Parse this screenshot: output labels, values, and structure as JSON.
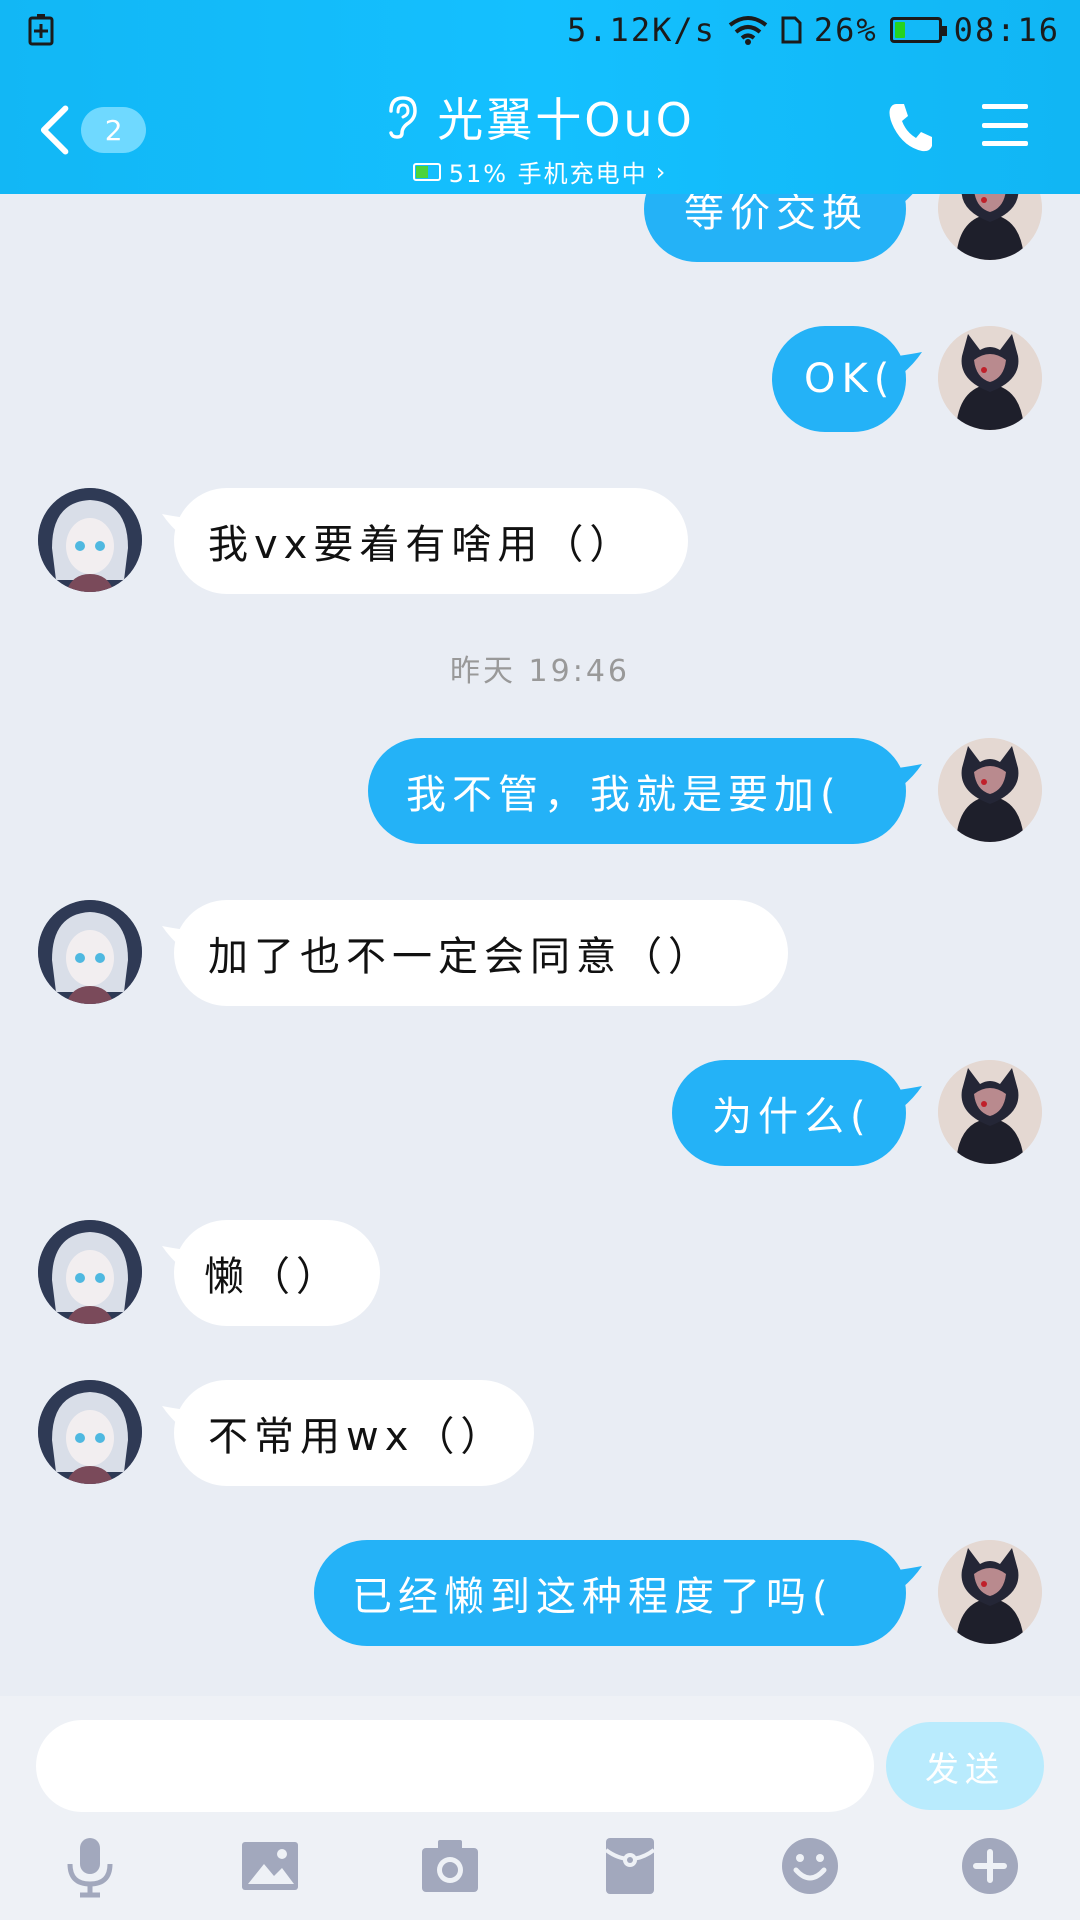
{
  "status_bar": {
    "net_speed": "5.12K/s",
    "battery_percent": "26%",
    "battery_level": 0.26,
    "time": "08:16"
  },
  "header": {
    "back_badge": "2",
    "contact_name": "光翼十OuO",
    "contact_status": "51% 手机充电中",
    "contact_battery_level": 0.51,
    "status_chevron": "›"
  },
  "messages": [
    {
      "side": "self",
      "text": "等价交换"
    },
    {
      "side": "self",
      "text": "OK("
    },
    {
      "side": "other",
      "text": "我vx要着有啥用（）"
    },
    {
      "side": "time",
      "text": "昨天 19:46"
    },
    {
      "side": "self",
      "text": "我不管，我就是要加("
    },
    {
      "side": "other",
      "text": "加了也不一定会同意（）"
    },
    {
      "side": "self",
      "text": "为什么("
    },
    {
      "side": "other",
      "text": "懒（）"
    },
    {
      "side": "other",
      "text": "不常用wx（）"
    },
    {
      "side": "self",
      "text": "已经懒到这种程度了吗("
    }
  ],
  "input": {
    "value": "",
    "send_label": "发送"
  },
  "toolbar_icons": [
    "microphone-icon",
    "image-icon",
    "camera-icon",
    "red-packet-icon",
    "emoji-icon",
    "plus-icon"
  ],
  "colors": {
    "header": "#12b7f5",
    "self_bubble": "#24b2f7",
    "other_bubble": "#ffffff",
    "background": "#e9edf4",
    "send_button": "#b9ebfd",
    "toolbar_icon": "#a2a8bd"
  }
}
